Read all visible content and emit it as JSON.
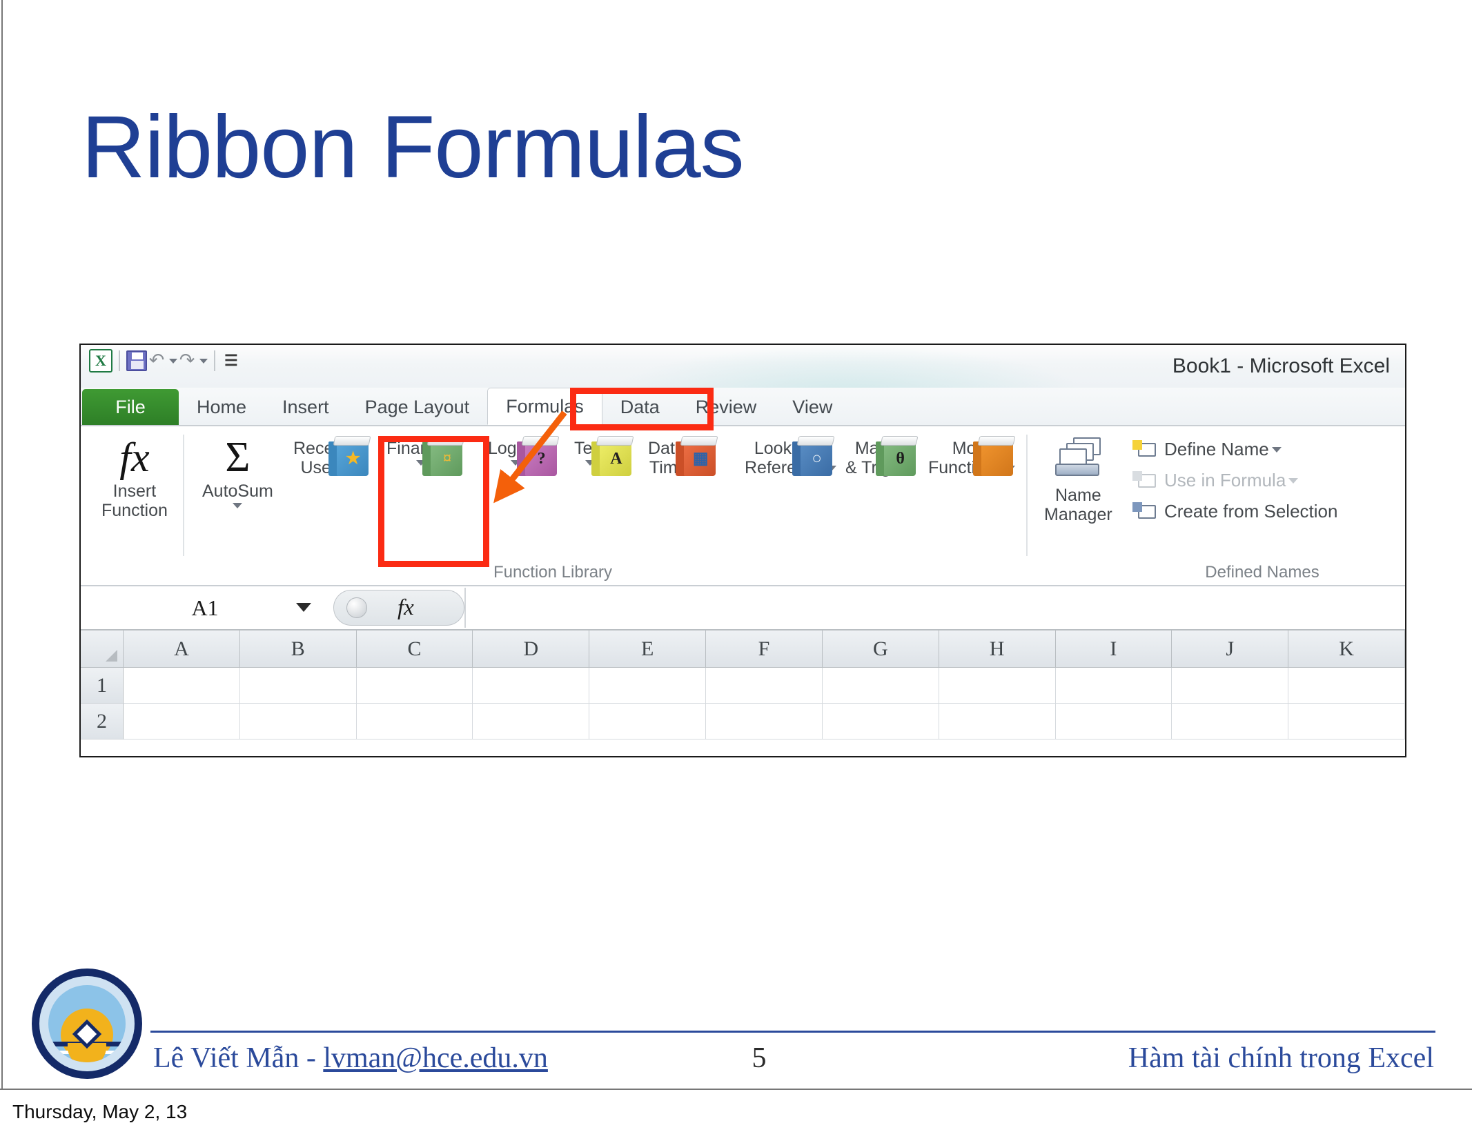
{
  "slide": {
    "title": "Ribbon Formulas",
    "title_color": "#1f3f94",
    "accent_color": "#2b4a9b",
    "highlight_color": "#fb2b13",
    "arrow_color": "#f4600a"
  },
  "excel": {
    "window_title": "Book1  -  Microsoft Excel",
    "quick_access": [
      {
        "name": "excel-logo",
        "glyph": "X"
      },
      {
        "name": "save-icon",
        "glyph": "save"
      },
      {
        "name": "undo-icon",
        "glyph": "↶"
      },
      {
        "name": "redo-icon",
        "glyph": "↷"
      },
      {
        "name": "customize-quick-access-icon",
        "glyph": "▼"
      }
    ],
    "tabs": [
      {
        "label": "File",
        "active": false,
        "type": "file"
      },
      {
        "label": "Home",
        "active": false
      },
      {
        "label": "Insert",
        "active": false
      },
      {
        "label": "Page Layout",
        "active": false
      },
      {
        "label": "Formulas",
        "active": true
      },
      {
        "label": "Data",
        "active": false
      },
      {
        "label": "Review",
        "active": false
      },
      {
        "label": "View",
        "active": false
      }
    ],
    "groups": [
      {
        "label": "Function Library",
        "buttons": [
          {
            "label_top": "Insert",
            "label_bottom": "Function",
            "icon": "fx-icon",
            "dropdown": false,
            "icon_kind": "fx"
          },
          {
            "label_top": "AutoSum",
            "label_bottom": "",
            "icon": "sigma-icon",
            "dropdown": true,
            "icon_kind": "sigma"
          },
          {
            "label_top": "Recently",
            "label_bottom": "Used",
            "icon": "recently-used-book-icon",
            "dropdown": true,
            "icon_kind": "book",
            "book_color": "#5aa8dc",
            "book_dark": "#3b87bd",
            "glyph": "★",
            "glyph_color": "#f3b826"
          },
          {
            "label_top": "Financial",
            "label_bottom": "",
            "icon": "financial-book-icon",
            "dropdown": true,
            "icon_kind": "book",
            "book_color": "#87bd84",
            "book_dark": "#5f9a5c",
            "glyph": "¤",
            "glyph_color": "#e8b93b",
            "highlighted": true
          },
          {
            "label_top": "Logical",
            "label_bottom": "",
            "icon": "logical-book-icon",
            "dropdown": true,
            "icon_kind": "book",
            "book_color": "#cc7fc4",
            "book_dark": "#a957a0",
            "glyph": "?",
            "glyph_color": "#221f22"
          },
          {
            "label_top": "Text",
            "label_bottom": "",
            "icon": "text-book-icon",
            "dropdown": true,
            "icon_kind": "book",
            "book_color": "#efef6a",
            "book_dark": "#cfcf3f",
            "glyph": "A",
            "glyph_color": "#221f22"
          },
          {
            "label_top": "Date &",
            "label_bottom": "Time",
            "icon": "date-time-book-icon",
            "dropdown": true,
            "icon_kind": "book",
            "book_color": "#ef7046",
            "book_dark": "#cb4f27",
            "glyph": "▦",
            "glyph_color": "#2f63a8"
          },
          {
            "label_top": "Lookup &",
            "label_bottom": "Reference",
            "icon": "lookup-reference-book-icon",
            "dropdown": true,
            "icon_kind": "book",
            "book_color": "#5b8fc6",
            "book_dark": "#3a6ca5",
            "glyph": "○",
            "glyph_color": "#e8eef5"
          },
          {
            "label_top": "Math",
            "label_bottom": "& Trig",
            "icon": "math-trig-book-icon",
            "dropdown": true,
            "icon_kind": "book",
            "book_color": "#87bd84",
            "book_dark": "#5f9a5c",
            "glyph": "θ",
            "glyph_color": "#1d1d1d"
          },
          {
            "label_top": "More",
            "label_bottom": "Functions",
            "icon": "more-functions-book-icon",
            "dropdown": true,
            "icon_kind": "book",
            "book_color": "#f2962f",
            "book_dark": "#d1761a",
            "glyph": "",
            "glyph_color": "#ffffff"
          }
        ]
      },
      {
        "label": "Defined Names",
        "buttons": [
          {
            "label_top": "Name",
            "label_bottom": "Manager",
            "icon": "name-manager-icon",
            "dropdown": false,
            "icon_kind": "namemgr"
          }
        ],
        "menu_items": [
          {
            "label": "Define Name",
            "icon": "define-name-icon",
            "dropdown": true,
            "disabled": false
          },
          {
            "label": "Use in Formula",
            "icon": "use-in-formula-icon",
            "dropdown": true,
            "disabled": true
          },
          {
            "label": "Create from Selection",
            "icon": "create-from-selection-icon",
            "dropdown": false,
            "disabled": false
          }
        ]
      }
    ],
    "formula_bar": {
      "name_box_value": "A1",
      "fx_label": "fx",
      "formula_value": ""
    },
    "sheet": {
      "columns": [
        "A",
        "B",
        "C",
        "D",
        "E",
        "F",
        "G",
        "H",
        "I",
        "J",
        "K"
      ],
      "rows": [
        "1",
        "2"
      ],
      "cells": [
        [
          "",
          "",
          "",
          "",
          "",
          "",
          "",
          "",
          "",
          "",
          ""
        ],
        [
          "",
          "",
          "",
          "",
          "",
          "",
          "",
          "",
          "",
          "",
          ""
        ]
      ]
    }
  },
  "footer": {
    "author_name": "Lê Viết Mẫn - ",
    "author_email": "lvman@hce.edu.vn",
    "page_number": "5",
    "right_text": "Hàm tài chính trong Excel",
    "datestamp": "Thursday, May 2, 13",
    "logo_name": "hue-college-of-economics-seal"
  }
}
